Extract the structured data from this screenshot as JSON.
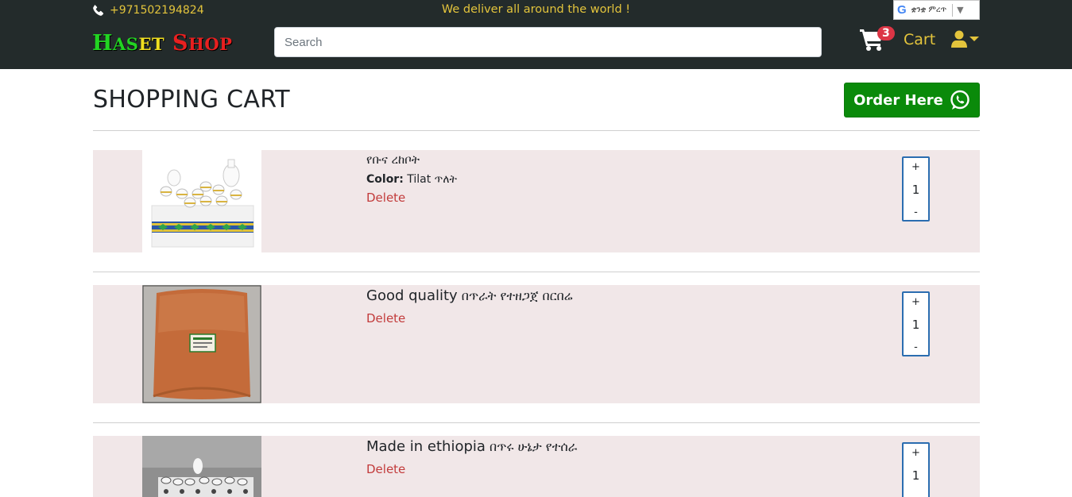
{
  "header": {
    "phone": "+971502194824",
    "tagline": "We deliver all around the world !",
    "translate": {
      "g": "G",
      "label": "ቋንቋ ምረጥ",
      "arrow": "▼"
    },
    "brand": {
      "p1": "H",
      "p2": "AS",
      "p3": "ET",
      "p4": " S",
      "p5": "HOP"
    },
    "search": {
      "placeholder": "Search"
    },
    "cart": {
      "count": "3",
      "label": "Cart"
    }
  },
  "page": {
    "title": "SHOPPING CART",
    "order_button": "Order Here"
  },
  "items": [
    {
      "name": "የቡና ረከቦት",
      "color_label": "Color:",
      "color_value": " Tilat ጥለት",
      "delete": "Delete",
      "qty_plus": "+",
      "qty": "1",
      "qty_minus": "-"
    },
    {
      "name_en": "Good quality",
      "name_am": " በጥራት የተዘጋጀ በርበሬ",
      "delete": "Delete",
      "qty_plus": "+",
      "qty": "1",
      "qty_minus": "-"
    },
    {
      "name_en": "Made in ethiopia",
      "name_am": " በጥሩ ሁኔታ የተሰራ",
      "delete": "Delete",
      "qty_plus": "+",
      "qty": "1",
      "qty_minus": "-"
    }
  ],
  "colors": {
    "navbar": "#232b2b",
    "accent": "#e3c43c",
    "order": "#0a8a0a",
    "row_bg": "#f1e7e8",
    "delete": "#c23b3b"
  }
}
